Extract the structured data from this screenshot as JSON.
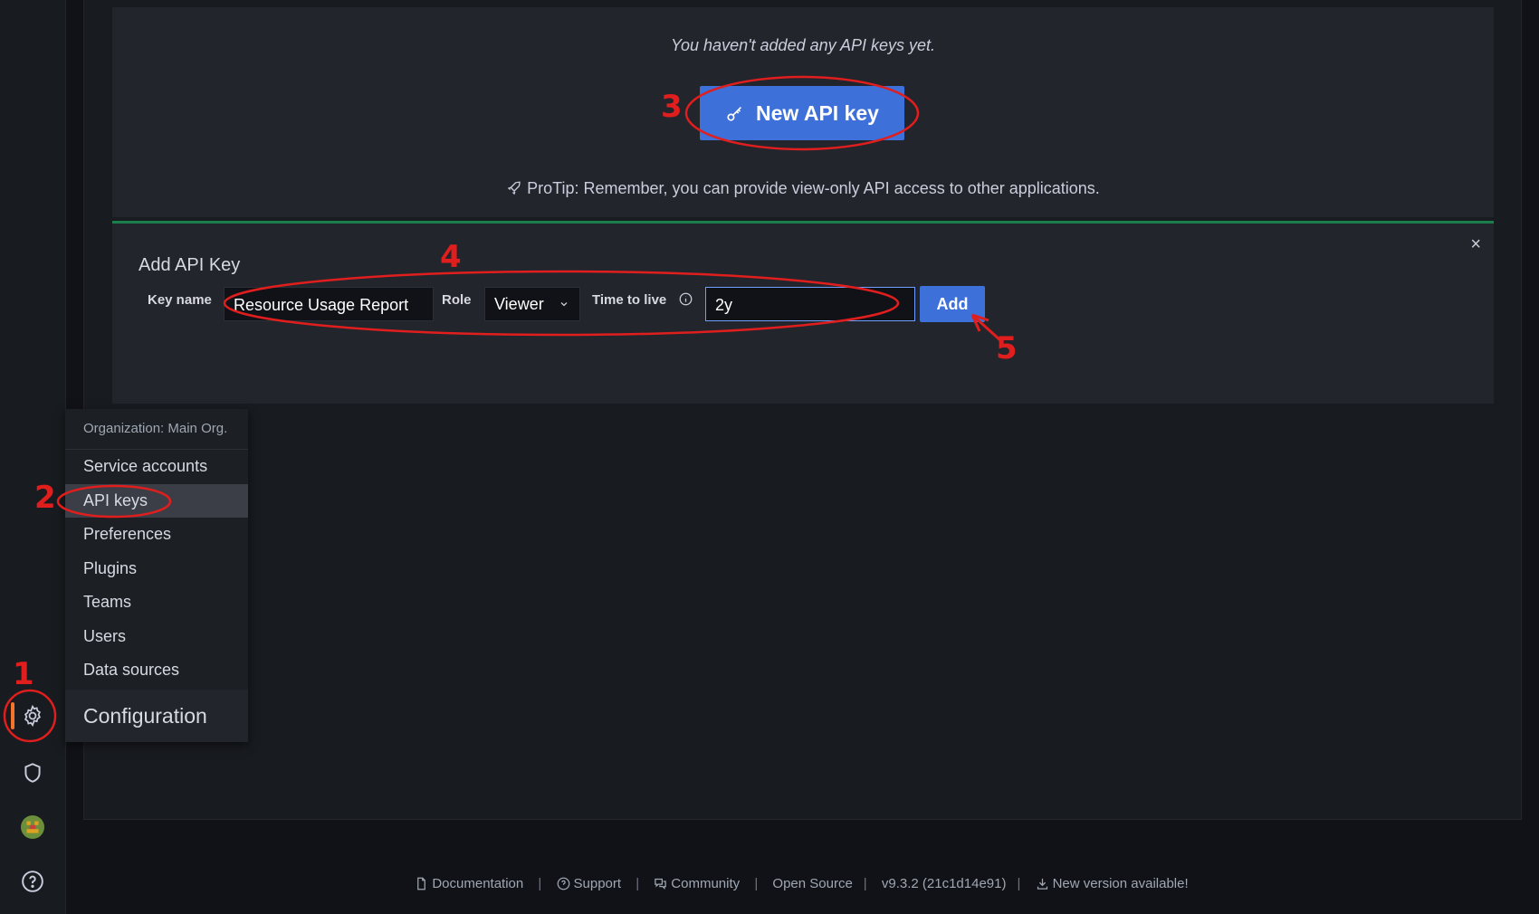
{
  "empty_state": {
    "message": "You haven't added any API keys yet.",
    "new_key_label": "New API key",
    "protip": "ProTip: Remember, you can provide view-only API access to other applications."
  },
  "add_form": {
    "title": "Add API Key",
    "close": "×",
    "key_name_label": "Key name",
    "key_name_value": "Resource Usage Report",
    "role_label": "Role",
    "role_value": "Viewer",
    "ttl_label": "Time to live",
    "ttl_value": "2y",
    "add_label": "Add"
  },
  "config_menu": {
    "header": "Organization: Main Org.",
    "items": [
      {
        "label": "Service accounts"
      },
      {
        "label": "API keys"
      },
      {
        "label": "Preferences"
      },
      {
        "label": "Plugins"
      },
      {
        "label": "Teams"
      },
      {
        "label": "Users"
      },
      {
        "label": "Data sources"
      }
    ],
    "title": "Configuration"
  },
  "footer": {
    "documentation": "Documentation",
    "support": "Support",
    "community": "Community",
    "open_source": "Open Source",
    "version": "v9.3.2 (21c1d14e91)",
    "new_version": "New version available!",
    "separator": "|"
  },
  "annotations": {
    "n1": "1",
    "n2": "2",
    "n3": "3",
    "n4": "4",
    "n5": "5"
  },
  "colors": {
    "accent": "#3d71d9",
    "success_border": "#1a7f4b",
    "annotation": "#e01e1e",
    "active_bar": "#f5742c"
  },
  "icons": {
    "new_key": "key-icon",
    "protip": "rocket-icon",
    "ttl_info": "info-icon",
    "sidebar": [
      "gear-icon",
      "shield-icon",
      "avatar",
      "help-icon"
    ]
  }
}
